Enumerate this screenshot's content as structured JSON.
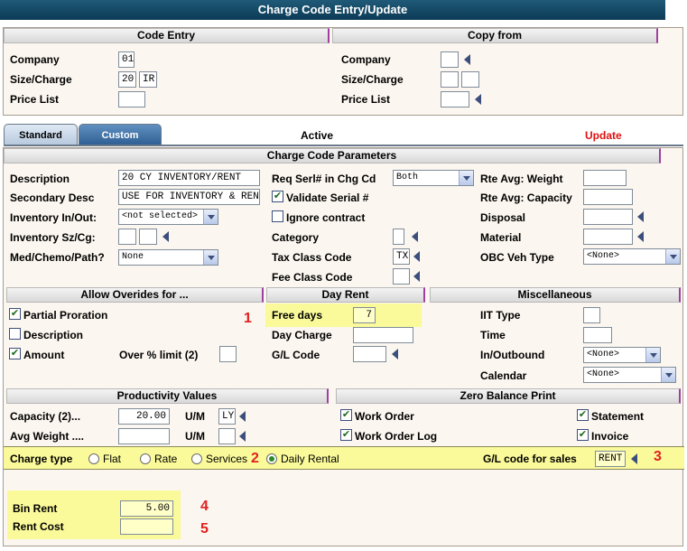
{
  "window": {
    "title": "Charge Code Entry/Update"
  },
  "code_entry": {
    "header": "Code Entry",
    "company_label": "Company",
    "company_value": "01",
    "size_charge_label": "Size/Charge",
    "size_value": "20",
    "charge_value": "IR",
    "price_list_label": "Price List",
    "price_list_value": ""
  },
  "copy_from": {
    "header": "Copy from",
    "company_label": "Company",
    "size_charge_label": "Size/Charge",
    "price_list_label": "Price List"
  },
  "tabs": {
    "standard": "Standard",
    "custom": "Custom"
  },
  "status": {
    "active": "Active",
    "update": "Update"
  },
  "params": {
    "header": "Charge Code Parameters",
    "description_label": "Description",
    "description_value": "20 CY INVENTORY/RENT",
    "secondary_desc_label": "Secondary Desc",
    "secondary_desc_value": "USE FOR INVENTORY & RENT",
    "inventory_inout_label": "Inventory In/Out:",
    "inventory_inout_value": "<not selected>",
    "inventory_szcg_label": "Inventory Sz/Cg:",
    "med_label": "Med/Chemo/Path?",
    "med_value": "None",
    "req_serl_label": "Req Serl# in Chg Cd",
    "req_serl_value": "Both",
    "validate_serial_label": "Validate Serial #",
    "ignore_contract_label": "Ignore contract",
    "category_label": "Category",
    "tax_class_label": "Tax Class Code",
    "tax_class_value": "TX",
    "fee_class_label": "Fee Class Code",
    "rte_avg_weight_label": "Rte Avg: Weight",
    "rte_avg_capacity_label": "Rte Avg: Capacity",
    "disposal_label": "Disposal",
    "material_label": "Material",
    "obc_label": "OBC Veh Type",
    "obc_value": "<None>"
  },
  "overrides": {
    "header": "Allow Overides for ...",
    "partial_label": "Partial Proration",
    "description_label": "Description",
    "amount_label": "Amount",
    "over_limit_label": "Over % limit (2)"
  },
  "day_rent": {
    "header": "Day Rent",
    "free_days_label": "Free days",
    "free_days_value": "7",
    "day_charge_label": "Day Charge",
    "gl_code_label": "G/L Code"
  },
  "misc": {
    "header": "Miscellaneous",
    "iit_label": "IIT Type",
    "time_label": "Time",
    "inout_label": "In/Outbound",
    "inout_value": "<None>",
    "calendar_label": "Calendar",
    "calendar_value": "<None>"
  },
  "productivity": {
    "header": "Productivity Values",
    "capacity_label": "Capacity  (2)...",
    "capacity_value": "20.00",
    "um_label": "U/M",
    "um_value": "LY",
    "avg_weight_label": "Avg Weight  ....",
    "um2_label": "U/M"
  },
  "zero_balance": {
    "header": "Zero Balance Print",
    "work_order_label": "Work Order",
    "work_order_log_label": "Work Order Log",
    "statement_label": "Statement",
    "invoice_label": "Invoice"
  },
  "charge_type": {
    "label": "Charge type",
    "options": [
      "Flat",
      "Rate",
      "Services",
      "Daily Rental"
    ],
    "gl_sales_label": "G/L code for sales",
    "gl_sales_value": "RENT"
  },
  "bin": {
    "bin_rent_label": "Bin Rent",
    "bin_rent_value": "5.00",
    "rent_cost_label": "Rent Cost"
  },
  "callouts": [
    "1",
    "2",
    "3",
    "4",
    "5"
  ],
  "colors": {
    "title_bar": "#0c3a55",
    "highlight": "#fafa9a",
    "update": "#e01010",
    "callout": "#e02020"
  }
}
